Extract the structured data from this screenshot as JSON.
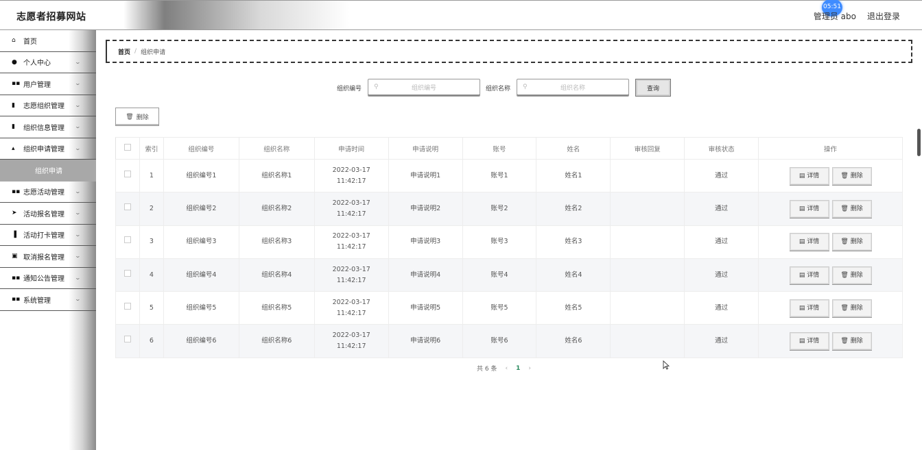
{
  "header": {
    "site_title": "志愿者招募网站",
    "user_label": "管理员 abo",
    "logout": "退出登录",
    "clock": "05:51"
  },
  "sidebar": {
    "items": [
      {
        "label": "首页",
        "icon": "home-icon",
        "glyph": "⌂",
        "has_chevron": false
      },
      {
        "label": "个人中心",
        "icon": "user-icon",
        "glyph": "●",
        "has_chevron": true
      },
      {
        "label": "用户管理",
        "icon": "grid-icon",
        "glyph": "▪▪",
        "has_chevron": true
      },
      {
        "label": "志愿组织管理",
        "icon": "book-icon",
        "glyph": "▮",
        "has_chevron": true
      },
      {
        "label": "组织信息管理",
        "icon": "trash-icon",
        "glyph": "▮",
        "has_chevron": true
      },
      {
        "label": "组织申请管理",
        "icon": "user-upload-icon",
        "glyph": "▴",
        "has_chevron": true
      },
      {
        "label": "组织申请",
        "icon": "",
        "glyph": "",
        "has_chevron": false,
        "sub": true
      },
      {
        "label": "志愿活动管理",
        "icon": "grid-icon",
        "glyph": "▪▪",
        "has_chevron": true
      },
      {
        "label": "活动报名管理",
        "icon": "send-icon",
        "glyph": "➤",
        "has_chevron": true
      },
      {
        "label": "活动打卡管理",
        "icon": "bar-chart-icon",
        "glyph": "▐",
        "has_chevron": true
      },
      {
        "label": "取消报名管理",
        "icon": "checkbox-icon",
        "glyph": "▣",
        "has_chevron": true
      },
      {
        "label": "通知公告管理",
        "icon": "grid-icon",
        "glyph": "▪▪",
        "has_chevron": true
      },
      {
        "label": "系统管理",
        "icon": "grid-icon",
        "glyph": "▪▪",
        "has_chevron": true
      }
    ]
  },
  "breadcrumb": {
    "home": "首页",
    "separator": "/",
    "current": "组织申请"
  },
  "search": {
    "field1_label": "组织编号",
    "field1_placeholder": "组织编号",
    "field2_label": "组织名称",
    "field2_placeholder": "组织名称",
    "query_button": "查询"
  },
  "actions": {
    "delete_label": "删除"
  },
  "table": {
    "headers": [
      "索引",
      "组织编号",
      "组织名称",
      "申请时间",
      "申请说明",
      "账号",
      "姓名",
      "审核回复",
      "审核状态",
      "操作"
    ],
    "rows": [
      {
        "index": "1",
        "org_no": "组织编号1",
        "org_name": "组织名称1",
        "time": "2022-03-17 11:42:17",
        "desc": "申请说明1",
        "account": "账号1",
        "name": "姓名1",
        "reply": "",
        "status": "通过"
      },
      {
        "index": "2",
        "org_no": "组织编号2",
        "org_name": "组织名称2",
        "time": "2022-03-17 11:42:17",
        "desc": "申请说明2",
        "account": "账号2",
        "name": "姓名2",
        "reply": "",
        "status": "通过"
      },
      {
        "index": "3",
        "org_no": "组织编号3",
        "org_name": "组织名称3",
        "time": "2022-03-17 11:42:17",
        "desc": "申请说明3",
        "account": "账号3",
        "name": "姓名3",
        "reply": "",
        "status": "通过"
      },
      {
        "index": "4",
        "org_no": "组织编号4",
        "org_name": "组织名称4",
        "time": "2022-03-17 11:42:17",
        "desc": "申请说明4",
        "account": "账号4",
        "name": "姓名4",
        "reply": "",
        "status": "通过"
      },
      {
        "index": "5",
        "org_no": "组织编号5",
        "org_name": "组织名称5",
        "time": "2022-03-17 11:42:17",
        "desc": "申请说明5",
        "account": "账号5",
        "name": "姓名5",
        "reply": "",
        "status": "通过"
      },
      {
        "index": "6",
        "org_no": "组织编号6",
        "org_name": "组织名称6",
        "time": "2022-03-17 11:42:17",
        "desc": "申请说明6",
        "account": "账号6",
        "name": "姓名6",
        "reply": "",
        "status": "通过"
      }
    ],
    "detail_label": "详情",
    "delete_label": "删除"
  },
  "pagination": {
    "total": "共 6 条",
    "current_page": "1",
    "prev": "‹",
    "next": "›"
  }
}
